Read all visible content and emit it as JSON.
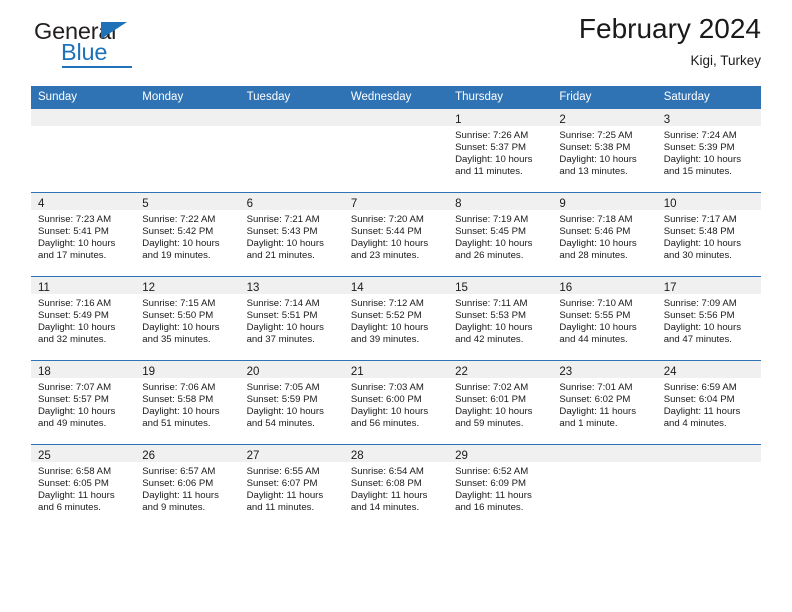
{
  "brand": {
    "name_top": "General",
    "name_bottom": "Blue",
    "accent_color": "#1f72b8"
  },
  "header": {
    "title": "February 2024",
    "subtitle": "Kigi, Turkey"
  },
  "theme": {
    "header_row_bg": "#2f73b5",
    "daynum_band_bg": "#f0f0f0",
    "grid_line": "#2f73b5",
    "text": "#1a1a1a"
  },
  "calendar": {
    "weekday_headers": [
      "Sunday",
      "Monday",
      "Tuesday",
      "Wednesday",
      "Thursday",
      "Friday",
      "Saturday"
    ],
    "weeks": [
      [
        {
          "day": "",
          "lines": []
        },
        {
          "day": "",
          "lines": []
        },
        {
          "day": "",
          "lines": []
        },
        {
          "day": "",
          "lines": []
        },
        {
          "day": "1",
          "lines": [
            "Sunrise: 7:26 AM",
            "Sunset: 5:37 PM",
            "Daylight: 10 hours",
            "and 11 minutes."
          ]
        },
        {
          "day": "2",
          "lines": [
            "Sunrise: 7:25 AM",
            "Sunset: 5:38 PM",
            "Daylight: 10 hours",
            "and 13 minutes."
          ]
        },
        {
          "day": "3",
          "lines": [
            "Sunrise: 7:24 AM",
            "Sunset: 5:39 PM",
            "Daylight: 10 hours",
            "and 15 minutes."
          ]
        }
      ],
      [
        {
          "day": "4",
          "lines": [
            "Sunrise: 7:23 AM",
            "Sunset: 5:41 PM",
            "Daylight: 10 hours",
            "and 17 minutes."
          ]
        },
        {
          "day": "5",
          "lines": [
            "Sunrise: 7:22 AM",
            "Sunset: 5:42 PM",
            "Daylight: 10 hours",
            "and 19 minutes."
          ]
        },
        {
          "day": "6",
          "lines": [
            "Sunrise: 7:21 AM",
            "Sunset: 5:43 PM",
            "Daylight: 10 hours",
            "and 21 minutes."
          ]
        },
        {
          "day": "7",
          "lines": [
            "Sunrise: 7:20 AM",
            "Sunset: 5:44 PM",
            "Daylight: 10 hours",
            "and 23 minutes."
          ]
        },
        {
          "day": "8",
          "lines": [
            "Sunrise: 7:19 AM",
            "Sunset: 5:45 PM",
            "Daylight: 10 hours",
            "and 26 minutes."
          ]
        },
        {
          "day": "9",
          "lines": [
            "Sunrise: 7:18 AM",
            "Sunset: 5:46 PM",
            "Daylight: 10 hours",
            "and 28 minutes."
          ]
        },
        {
          "day": "10",
          "lines": [
            "Sunrise: 7:17 AM",
            "Sunset: 5:48 PM",
            "Daylight: 10 hours",
            "and 30 minutes."
          ]
        }
      ],
      [
        {
          "day": "11",
          "lines": [
            "Sunrise: 7:16 AM",
            "Sunset: 5:49 PM",
            "Daylight: 10 hours",
            "and 32 minutes."
          ]
        },
        {
          "day": "12",
          "lines": [
            "Sunrise: 7:15 AM",
            "Sunset: 5:50 PM",
            "Daylight: 10 hours",
            "and 35 minutes."
          ]
        },
        {
          "day": "13",
          "lines": [
            "Sunrise: 7:14 AM",
            "Sunset: 5:51 PM",
            "Daylight: 10 hours",
            "and 37 minutes."
          ]
        },
        {
          "day": "14",
          "lines": [
            "Sunrise: 7:12 AM",
            "Sunset: 5:52 PM",
            "Daylight: 10 hours",
            "and 39 minutes."
          ]
        },
        {
          "day": "15",
          "lines": [
            "Sunrise: 7:11 AM",
            "Sunset: 5:53 PM",
            "Daylight: 10 hours",
            "and 42 minutes."
          ]
        },
        {
          "day": "16",
          "lines": [
            "Sunrise: 7:10 AM",
            "Sunset: 5:55 PM",
            "Daylight: 10 hours",
            "and 44 minutes."
          ]
        },
        {
          "day": "17",
          "lines": [
            "Sunrise: 7:09 AM",
            "Sunset: 5:56 PM",
            "Daylight: 10 hours",
            "and 47 minutes."
          ]
        }
      ],
      [
        {
          "day": "18",
          "lines": [
            "Sunrise: 7:07 AM",
            "Sunset: 5:57 PM",
            "Daylight: 10 hours",
            "and 49 minutes."
          ]
        },
        {
          "day": "19",
          "lines": [
            "Sunrise: 7:06 AM",
            "Sunset: 5:58 PM",
            "Daylight: 10 hours",
            "and 51 minutes."
          ]
        },
        {
          "day": "20",
          "lines": [
            "Sunrise: 7:05 AM",
            "Sunset: 5:59 PM",
            "Daylight: 10 hours",
            "and 54 minutes."
          ]
        },
        {
          "day": "21",
          "lines": [
            "Sunrise: 7:03 AM",
            "Sunset: 6:00 PM",
            "Daylight: 10 hours",
            "and 56 minutes."
          ]
        },
        {
          "day": "22",
          "lines": [
            "Sunrise: 7:02 AM",
            "Sunset: 6:01 PM",
            "Daylight: 10 hours",
            "and 59 minutes."
          ]
        },
        {
          "day": "23",
          "lines": [
            "Sunrise: 7:01 AM",
            "Sunset: 6:02 PM",
            "Daylight: 11 hours",
            "and 1 minute."
          ]
        },
        {
          "day": "24",
          "lines": [
            "Sunrise: 6:59 AM",
            "Sunset: 6:04 PM",
            "Daylight: 11 hours",
            "and 4 minutes."
          ]
        }
      ],
      [
        {
          "day": "25",
          "lines": [
            "Sunrise: 6:58 AM",
            "Sunset: 6:05 PM",
            "Daylight: 11 hours",
            "and 6 minutes."
          ]
        },
        {
          "day": "26",
          "lines": [
            "Sunrise: 6:57 AM",
            "Sunset: 6:06 PM",
            "Daylight: 11 hours",
            "and 9 minutes."
          ]
        },
        {
          "day": "27",
          "lines": [
            "Sunrise: 6:55 AM",
            "Sunset: 6:07 PM",
            "Daylight: 11 hours",
            "and 11 minutes."
          ]
        },
        {
          "day": "28",
          "lines": [
            "Sunrise: 6:54 AM",
            "Sunset: 6:08 PM",
            "Daylight: 11 hours",
            "and 14 minutes."
          ]
        },
        {
          "day": "29",
          "lines": [
            "Sunrise: 6:52 AM",
            "Sunset: 6:09 PM",
            "Daylight: 11 hours",
            "and 16 minutes."
          ]
        },
        {
          "day": "",
          "lines": []
        },
        {
          "day": "",
          "lines": []
        }
      ]
    ]
  }
}
